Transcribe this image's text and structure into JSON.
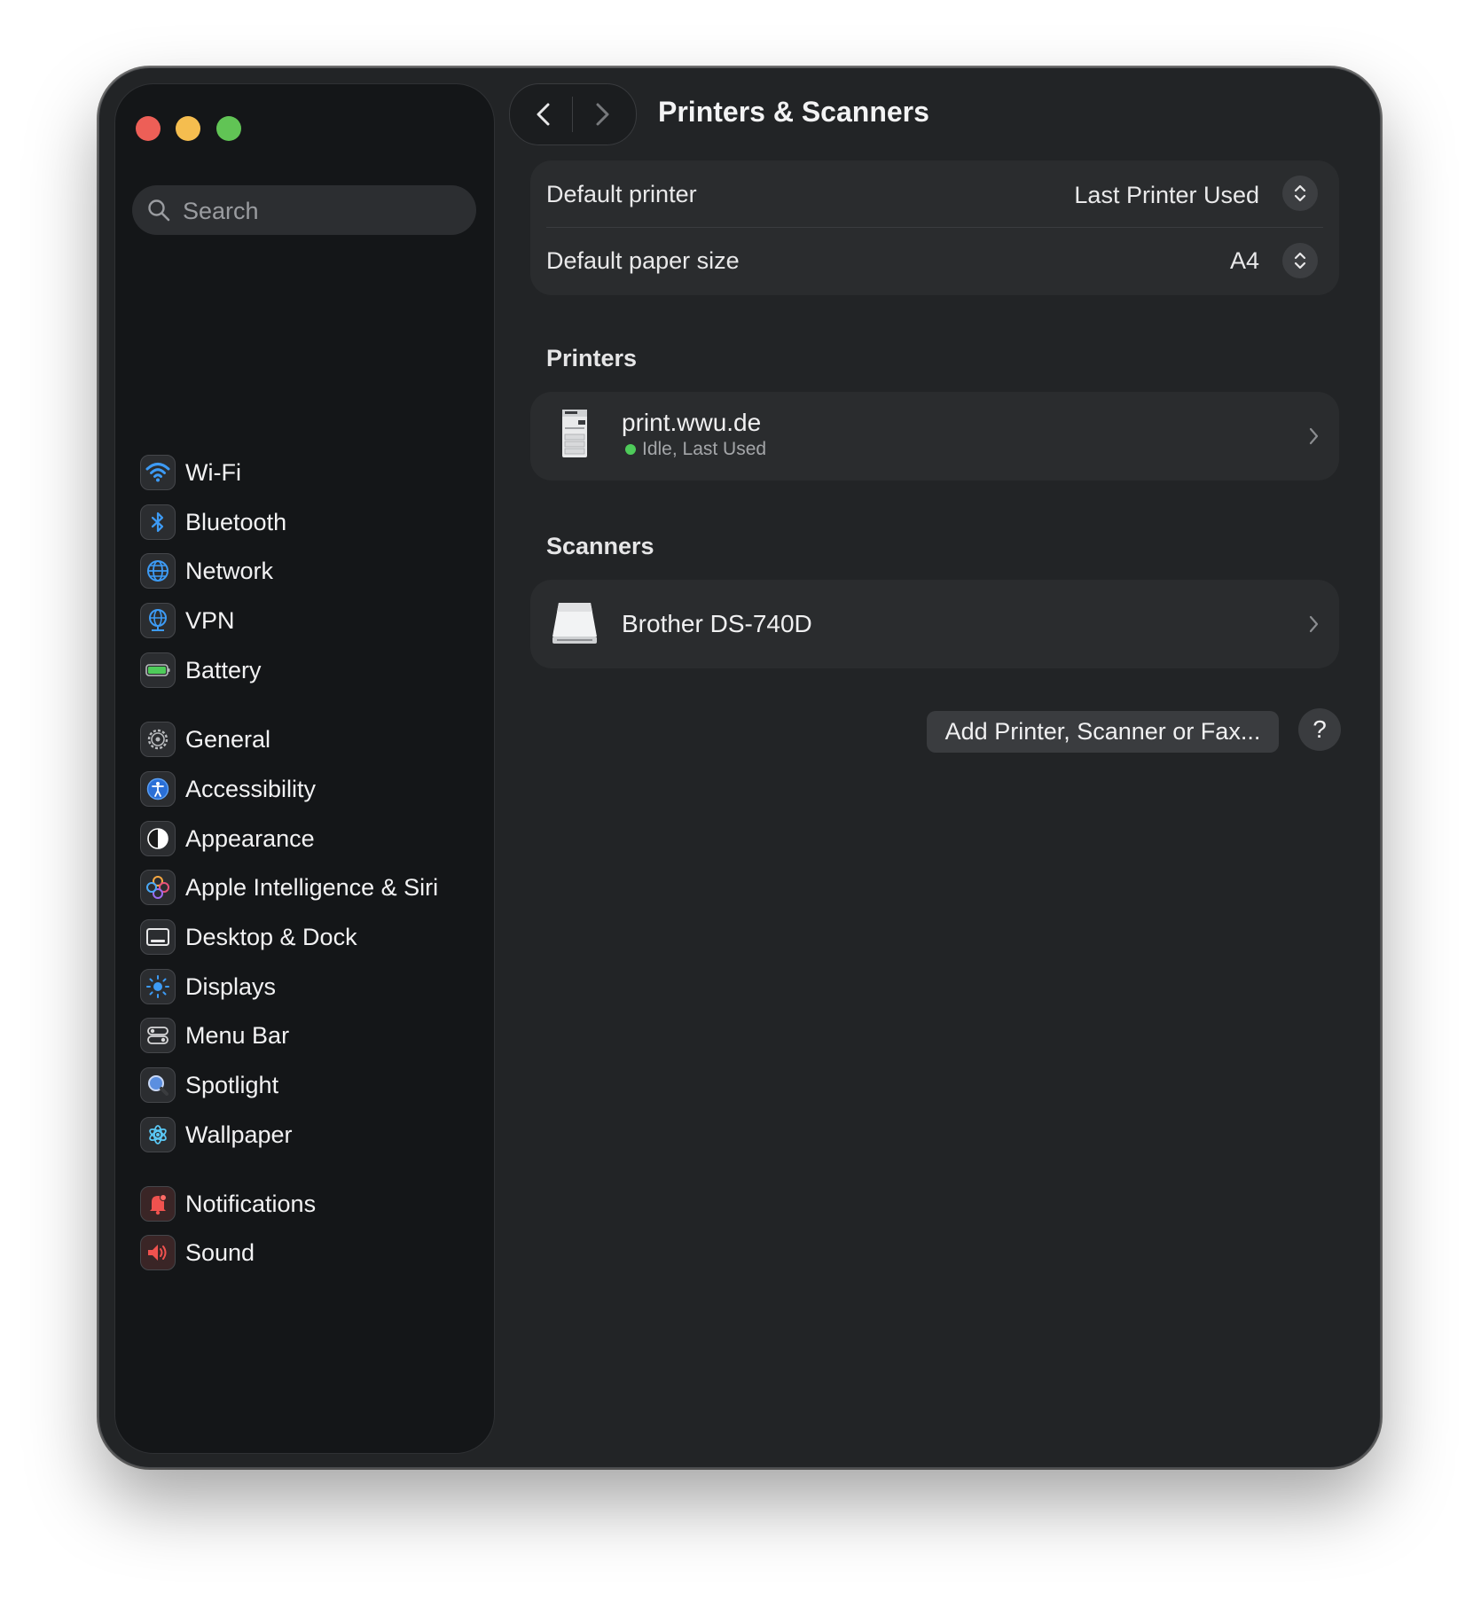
{
  "window": {
    "title": "Printers & Scanners"
  },
  "search": {
    "placeholder": "Search"
  },
  "sidebar": {
    "items": [
      {
        "label": "Wi-Fi",
        "icon": "wifi-icon"
      },
      {
        "label": "Bluetooth",
        "icon": "bluetooth-icon"
      },
      {
        "label": "Network",
        "icon": "globe-icon"
      },
      {
        "label": "VPN",
        "icon": "vpn-globe-icon"
      },
      {
        "label": "Battery",
        "icon": "battery-icon"
      },
      {
        "label": "General",
        "icon": "gear-icon"
      },
      {
        "label": "Accessibility",
        "icon": "accessibility-icon"
      },
      {
        "label": "Appearance",
        "icon": "appearance-icon"
      },
      {
        "label": "Apple Intelligence & Siri",
        "icon": "siri-icon"
      },
      {
        "label": "Desktop & Dock",
        "icon": "dock-icon"
      },
      {
        "label": "Displays",
        "icon": "sun-icon"
      },
      {
        "label": "Menu Bar",
        "icon": "menubar-icon"
      },
      {
        "label": "Spotlight",
        "icon": "magnifier-icon"
      },
      {
        "label": "Wallpaper",
        "icon": "flower-icon"
      },
      {
        "label": "Notifications",
        "icon": "bell-icon"
      },
      {
        "label": "Sound",
        "icon": "speaker-icon"
      }
    ]
  },
  "defaults": {
    "printer_label": "Default printer",
    "printer_value": "Last Printer Used",
    "paper_label": "Default paper size",
    "paper_value": "A4"
  },
  "printers": {
    "title": "Printers",
    "items": [
      {
        "name": "print.wwu.de",
        "status": "Idle, Last Used",
        "icon": "printer-icon"
      }
    ]
  },
  "scanners": {
    "title": "Scanners",
    "items": [
      {
        "name": "Brother DS-740D",
        "icon": "scanner-icon"
      }
    ]
  },
  "actions": {
    "add_label": "Add Printer, Scanner or Fax...",
    "help_label": "?"
  },
  "colors": {
    "window_bg": "#222426",
    "sidebar_bg": "#141618",
    "card_bg": "#2a2c2e",
    "status_green": "#4ecb5a",
    "close": "#ed5f57",
    "minimize": "#f5bd4f",
    "zoom": "#61c455"
  }
}
